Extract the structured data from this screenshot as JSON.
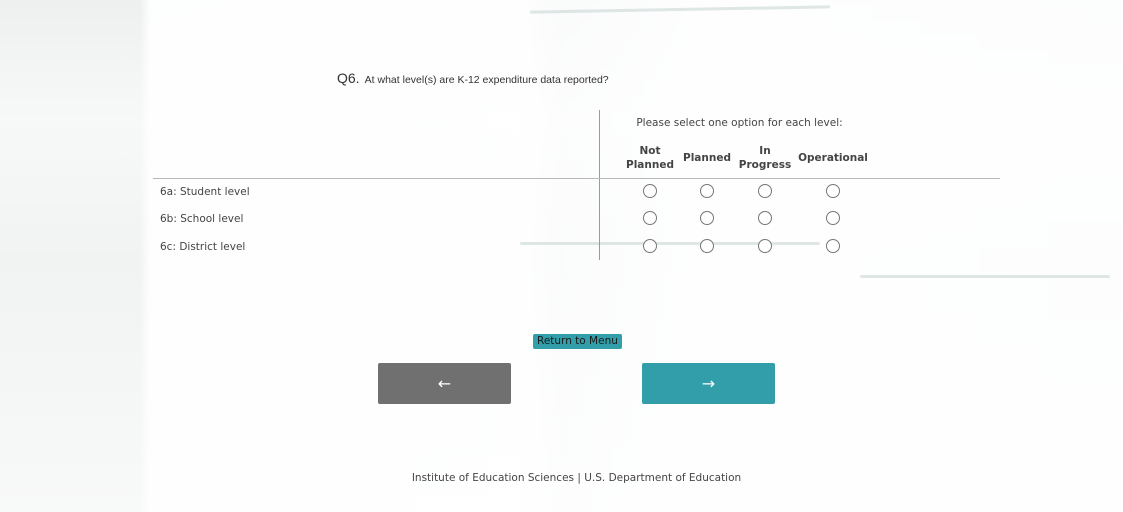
{
  "question": {
    "number": "Q6.",
    "text": "At what level(s) are K-12 expenditure data reported?"
  },
  "matrix": {
    "instruction": "Please select one option for each level:",
    "columns": [
      {
        "line1": "Not",
        "line2": "Planned"
      },
      {
        "line1": "Planned",
        "line2": ""
      },
      {
        "line1": "In",
        "line2": "Progress"
      },
      {
        "line1": "Operational",
        "line2": ""
      }
    ],
    "rows": [
      {
        "label": "6a: Student level"
      },
      {
        "label": "6b: School level"
      },
      {
        "label": "6c: District level"
      }
    ]
  },
  "nav": {
    "menu_label": "Return to Menu",
    "back_label": "←",
    "next_label": "→"
  },
  "footer": {
    "text": "Institute of Education Sciences | U.S. Department of Education"
  },
  "colors": {
    "accent": "#319ea9",
    "back_button": "#707070"
  }
}
